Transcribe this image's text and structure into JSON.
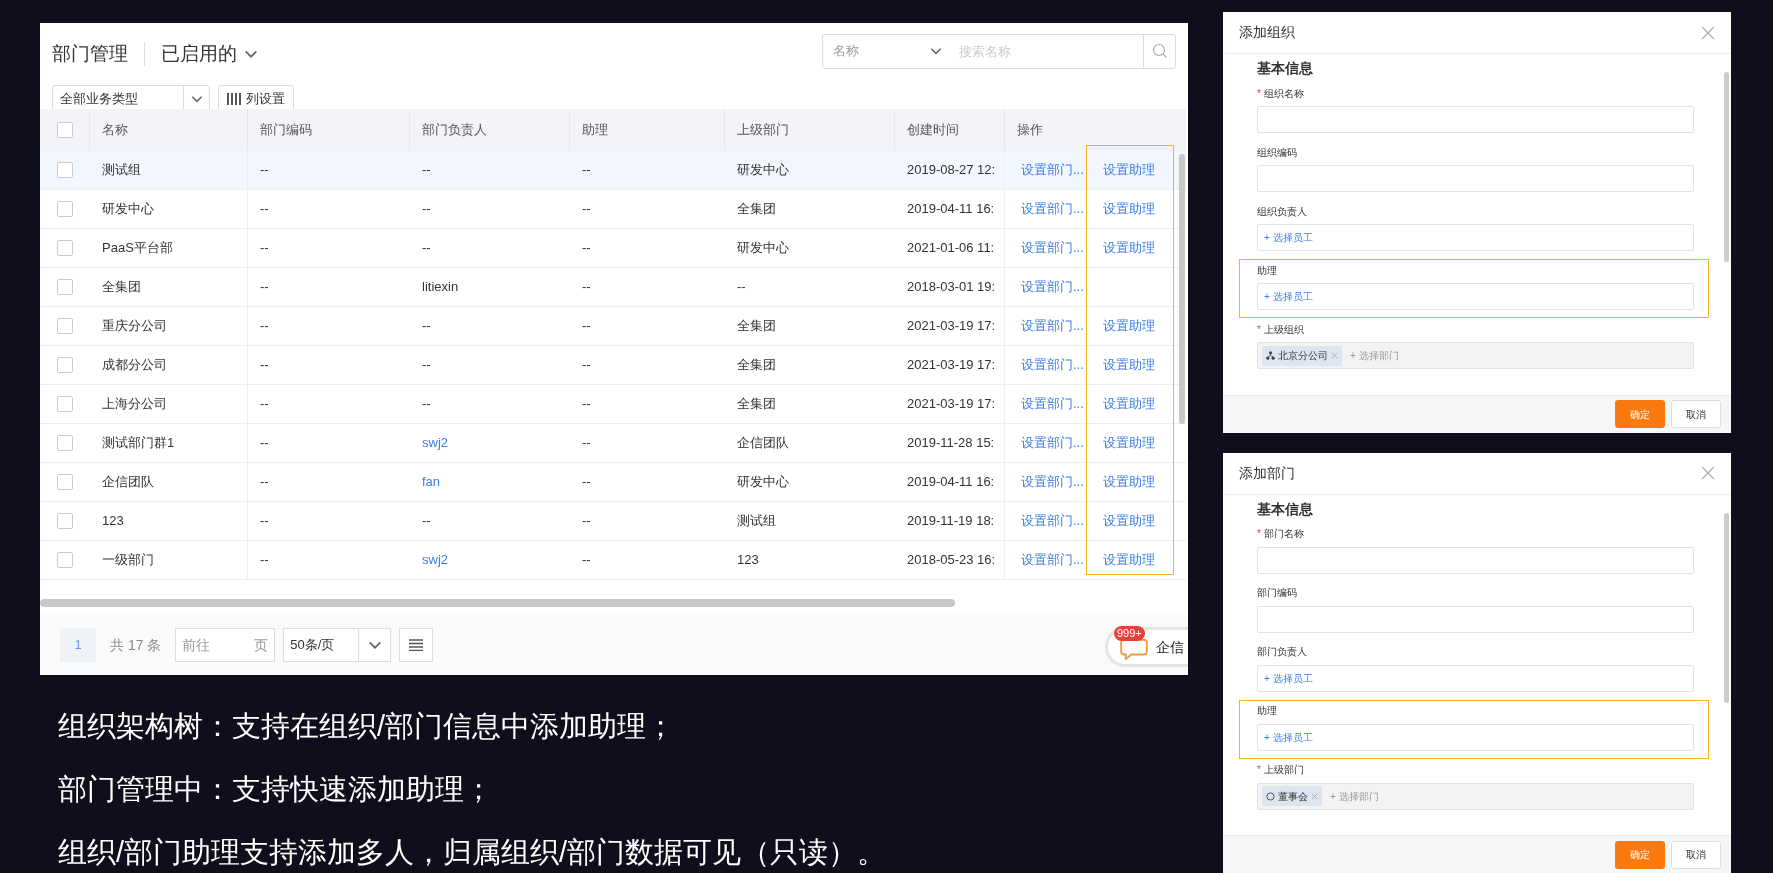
{
  "dept_panel": {
    "title": "部门管理",
    "view": "已启用的",
    "type_filter": "全部业务类型",
    "column_settings": "列设置",
    "search": {
      "field": "名称",
      "placeholder": "搜索名称"
    },
    "table": {
      "header_checked": false,
      "columns": [
        "名称",
        "部门编码",
        "部门负责人",
        "助理",
        "上级部门",
        "创建时间",
        "操作"
      ],
      "rows": [
        {
          "selected": true,
          "checked": false,
          "name": "测试组",
          "code": "--",
          "leader": "--",
          "leader_link": false,
          "assistant": "--",
          "parent": "研发中心",
          "created": "2019-08-27 12:",
          "actions": [
            "设置部门...",
            "设置助理"
          ]
        },
        {
          "selected": false,
          "checked": false,
          "name": "研发中心",
          "code": "--",
          "leader": "--",
          "leader_link": false,
          "assistant": "--",
          "parent": "全集团",
          "created": "2019-04-11 16:",
          "actions": [
            "设置部门...",
            "设置助理"
          ]
        },
        {
          "selected": false,
          "checked": false,
          "name": "PaaS平台部",
          "code": "--",
          "leader": "--",
          "leader_link": false,
          "assistant": "--",
          "parent": "研发中心",
          "created": "2021-01-06 11:",
          "actions": [
            "设置部门...",
            "设置助理"
          ]
        },
        {
          "selected": false,
          "checked": false,
          "name": "全集团",
          "code": "--",
          "leader": "litiexin",
          "leader_link": false,
          "assistant": "--",
          "parent": "--",
          "created": "2018-03-01 19:",
          "actions": [
            "设置部门..."
          ]
        },
        {
          "selected": false,
          "checked": false,
          "name": "重庆分公司",
          "code": "--",
          "leader": "--",
          "leader_link": false,
          "assistant": "--",
          "parent": "全集团",
          "created": "2021-03-19 17:",
          "actions": [
            "设置部门...",
            "设置助理"
          ]
        },
        {
          "selected": false,
          "checked": false,
          "name": "成都分公司",
          "code": "--",
          "leader": "--",
          "leader_link": false,
          "assistant": "--",
          "parent": "全集团",
          "created": "2021-03-19 17:",
          "actions": [
            "设置部门...",
            "设置助理"
          ]
        },
        {
          "selected": false,
          "checked": false,
          "name": "上海分公司",
          "code": "--",
          "leader": "--",
          "leader_link": false,
          "assistant": "--",
          "parent": "全集团",
          "created": "2021-03-19 17:",
          "actions": [
            "设置部门...",
            "设置助理"
          ]
        },
        {
          "selected": false,
          "checked": false,
          "name": "测试部门群1",
          "code": "--",
          "leader": "swj2",
          "leader_link": true,
          "assistant": "--",
          "parent": "企信团队",
          "created": "2019-11-28 15:",
          "actions": [
            "设置部门...",
            "设置助理"
          ]
        },
        {
          "selected": false,
          "checked": false,
          "name": "企信团队",
          "code": "--",
          "leader": "fan",
          "leader_link": true,
          "assistant": "--",
          "parent": "研发中心",
          "created": "2019-04-11 16:",
          "actions": [
            "设置部门...",
            "设置助理"
          ]
        },
        {
          "selected": false,
          "checked": false,
          "name": "123",
          "code": "--",
          "leader": "--",
          "leader_link": false,
          "assistant": "--",
          "parent": "测试组",
          "created": "2019-11-19 18:",
          "actions": [
            "设置部门...",
            "设置助理"
          ]
        },
        {
          "selected": false,
          "checked": false,
          "name": "一级部门",
          "code": "--",
          "leader": "swj2",
          "leader_link": true,
          "assistant": "--",
          "parent": "123",
          "created": "2018-05-23 16:",
          "actions": [
            "设置部门...",
            "设置助理"
          ]
        }
      ]
    },
    "pagination": {
      "page": "1",
      "total": "共 17 条",
      "goto": "前往",
      "goto_unit": "页",
      "page_size": "50条/页"
    },
    "chat_badge": {
      "count": "999+",
      "label": "企信"
    }
  },
  "dialogs": [
    {
      "title": "添加组织",
      "section": "基本信息",
      "fields": [
        {
          "kind": "text",
          "label": "组织名称",
          "required_mark": "*",
          "highlight": false
        },
        {
          "kind": "text",
          "label": "组织编码",
          "highlight": false
        },
        {
          "kind": "picker",
          "label": "组织负责人",
          "highlight": false,
          "action": "+ 选择员工"
        },
        {
          "kind": "picker",
          "label": "助理",
          "highlight": true,
          "action": "+ 选择员工"
        },
        {
          "kind": "tags",
          "label": "上级组织",
          "required_mark": "*",
          "highlight": false,
          "tags": [
            {
              "kind": "org",
              "text": "北京分公司"
            }
          ],
          "action": "+ 选择部门"
        }
      ],
      "buttons": [
        "确定",
        "取消"
      ]
    },
    {
      "title": "添加部门",
      "section": "基本信息",
      "fields": [
        {
          "kind": "text",
          "label": "部门名称",
          "required_mark": "*",
          "highlight": false
        },
        {
          "kind": "text",
          "label": "部门编码",
          "highlight": false
        },
        {
          "kind": "picker",
          "label": "部门负责人",
          "highlight": false,
          "action": "+ 选择员工"
        },
        {
          "kind": "picker",
          "label": "助理",
          "highlight": true,
          "action": "+ 选择员工"
        },
        {
          "kind": "tags",
          "label": "上级部门",
          "required_mark": "*",
          "highlight": false,
          "tags": [
            {
              "kind": "dept",
              "text": "董事会"
            }
          ],
          "action": "+ 选择部门"
        }
      ],
      "buttons": [
        "确定",
        "取消"
      ]
    }
  ],
  "notes": [
    "组织架构树：支持在组织/部门信息中添加助理；",
    "部门管理中：支持快速添加助理；",
    "组织/部门助理支持添加多人，归属组织/部门数据可见（只读）。"
  ]
}
